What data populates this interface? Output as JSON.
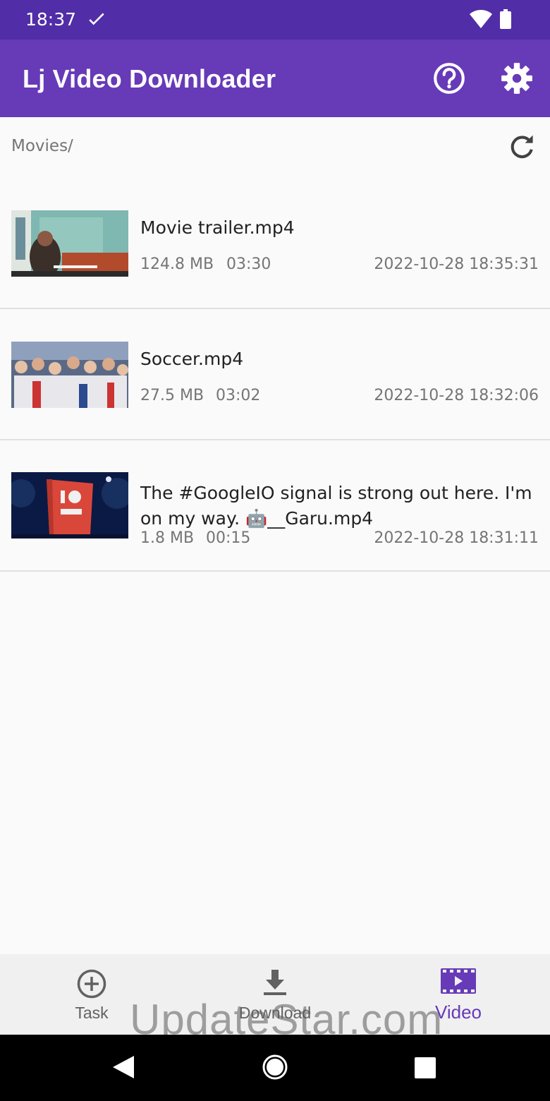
{
  "status_bar": {
    "time": "18:37"
  },
  "app_bar": {
    "title": "Lj Video Downloader",
    "help_icon": "help-circle-icon",
    "settings_icon": "gear-icon"
  },
  "path": {
    "label": "Movies/",
    "refresh_icon": "refresh-icon"
  },
  "videos": [
    {
      "name": "Movie trailer.mp4",
      "size": "124.8 MB",
      "duration": "03:30",
      "date": "2022-10-28 18:35:31"
    },
    {
      "name": "Soccer.mp4",
      "size": "27.5 MB",
      "duration": "03:02",
      "date": "2022-10-28 18:32:06"
    },
    {
      "name": "The #GoogleIO signal is strong out here. I'm on my way. 🤖__Garu.mp4",
      "size": "1.8 MB",
      "duration": "00:15",
      "date": "2022-10-28 18:31:11"
    }
  ],
  "bottom_nav": {
    "items": [
      {
        "label": "Task",
        "icon": "add-circle-icon"
      },
      {
        "label": "Download",
        "icon": "download-icon"
      },
      {
        "label": "Video",
        "icon": "video-icon",
        "active": true
      }
    ]
  },
  "watermark": "UpdateStar.com",
  "colors": {
    "status_bar": "#512da8",
    "app_bar": "#673ab7",
    "accent": "#673ab7"
  }
}
